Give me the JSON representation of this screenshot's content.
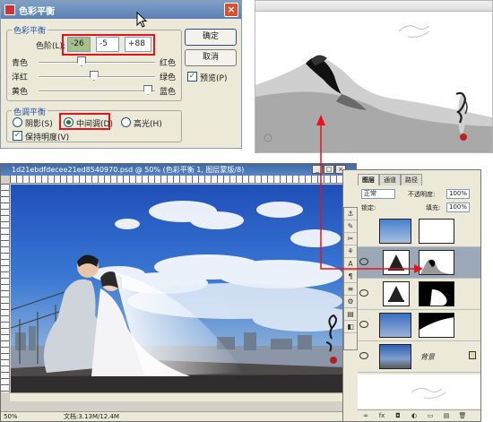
{
  "dialog": {
    "title": "色彩平衡",
    "close_glyph": "×",
    "balance_group": "色彩平衡",
    "levels_label": "色阶(L):",
    "levels": [
      "-26",
      "-5",
      "+88"
    ],
    "sliders": [
      {
        "left": "青色",
        "right": "红色",
        "value": -26
      },
      {
        "left": "洋红",
        "right": "绿色",
        "value": -5
      },
      {
        "left": "黄色",
        "right": "蓝色",
        "value": 88
      }
    ],
    "tone_group": "色调平衡",
    "shadows": "阴影(S)",
    "midtones": "中间调(D)",
    "highlights": "高光(H)",
    "preserve_luminosity": "保持明度(V)",
    "ok": "确定",
    "cancel": "取消",
    "preview": "预览(P)",
    "check_glyph": "✓"
  },
  "document": {
    "title": "1d21ebdfdecee21ed8540970.psd @ 50% (色彩平衡 1, 图层蒙版/8)",
    "zoom": "50%",
    "doc_size": "文档:3.13M/12.4M",
    "window_buttons": [
      "_",
      "□",
      "×"
    ]
  },
  "layers_panel": {
    "tabs": [
      "图层",
      "通道",
      "路径"
    ],
    "blend_mode": "正常",
    "opacity_label": "不透明度:",
    "opacity": "100%",
    "lock_label": "锁定:",
    "fill_label": "填充:",
    "fill": "100%",
    "background_name": "背景",
    "footer_icons": [
      "link-icon",
      "fx-icon",
      "mask-icon",
      "adjustment-icon",
      "folder-icon",
      "new-layer-icon",
      "trash-icon"
    ],
    "footer_glyphs": [
      "∞",
      "fx",
      "◘",
      "◐",
      "▭",
      "▤",
      "🗑"
    ]
  },
  "tools": [
    "⚓",
    "✎",
    "✂",
    "⚘",
    "A",
    "¶",
    "≡",
    "⚙",
    "▤",
    "◧"
  ],
  "colors": {
    "highlight_red": "#e8131a",
    "dialog_bg": "#ece9d8",
    "title_blue": "#5c80b4"
  }
}
